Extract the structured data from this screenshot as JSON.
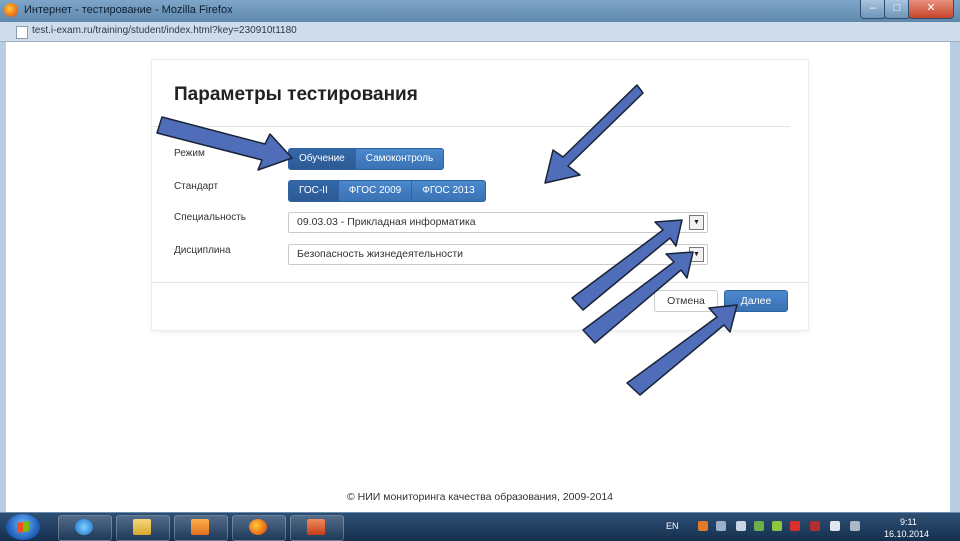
{
  "window": {
    "title": "Интернет - тестирование - Mozilla Firefox",
    "url": "test.i-exam.ru/training/student/index.html?key=230910t1180",
    "min_glyph": "–",
    "max_glyph": "□",
    "close_glyph": "✕"
  },
  "dialog": {
    "title": "Параметры тестирования",
    "mode": {
      "label": "Режим",
      "options": [
        "Обучение",
        "Самоконтроль"
      ],
      "selected": "Обучение"
    },
    "standard": {
      "label": "Стандарт",
      "options": [
        "ГОС-II",
        "ФГОС 2009",
        "ФГОС 2013"
      ],
      "selected": "ГОС-II"
    },
    "specialty": {
      "label": "Специальность",
      "value": "09.03.03 - Прикладная информатика"
    },
    "discipline": {
      "label": "Дисциплина",
      "value": "Безопасность жизнедеятельности"
    },
    "cancel_label": "Отмена",
    "next_label": "Далее",
    "select_arrow_glyph": "▼"
  },
  "footer": "© НИИ мониторинга качества образования, 2009-2014",
  "taskbar": {
    "items": [
      "internet-explorer-icon",
      "file-explorer-icon",
      "media-player-icon",
      "firefox-icon",
      "powerpoint-icon"
    ],
    "language": "EN",
    "time": "9:11",
    "date": "16.10.2014"
  },
  "colors": {
    "accent": "#3a72b5",
    "arrow_fill": "#4f6db8",
    "arrow_stroke": "#1a2338"
  }
}
